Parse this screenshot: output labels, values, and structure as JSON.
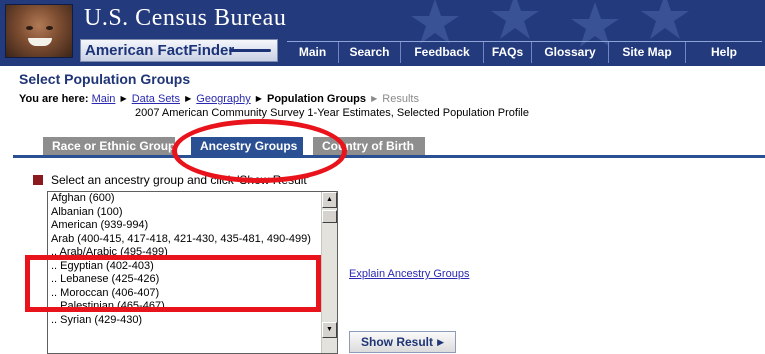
{
  "header": {
    "title": "U.S. Census Bureau",
    "product": "American FactFinder",
    "nav": [
      "Main",
      "Search",
      "Feedback",
      "FAQs",
      "Glossary",
      "Site Map",
      "Help"
    ]
  },
  "page": {
    "title": "Select Population Groups",
    "breadcrumb": {
      "label": "You are here:",
      "links": [
        "Main",
        "Data Sets",
        "Geography"
      ],
      "current": "Population Groups",
      "next": "Results"
    },
    "subtitle": "2007 American Community Survey 1-Year Estimates, Selected Population Profile"
  },
  "tabs": [
    "Race or Ethnic Groups",
    "Ancestry Groups",
    "Country of Birth"
  ],
  "active_tab": "Ancestry Groups",
  "instruction": "Select an ancestry group and click 'Show Result'",
  "ancestry_options": [
    "Afghan (600)",
    "Albanian (100)",
    "American (939-994)",
    "Arab (400-415, 417-418, 421-430, 435-481, 490-499)",
    ".. Arab/Arabic (495-499)",
    ".. Egyptian (402-403)",
    ".. Lebanese (425-426)",
    ".. Moroccan (406-407)",
    ".. Palestinian (465-467)",
    ".. Syrian (429-430)"
  ],
  "explain_link": "Explain Ancestry Groups",
  "show_result_label": "Show Result",
  "colors": {
    "header_blue": "#233a7c",
    "tab_active": "#2a4f92",
    "tab_inactive": "#8e8e8e",
    "annotation_red": "#e8131b",
    "link": "#2a2ab0"
  }
}
